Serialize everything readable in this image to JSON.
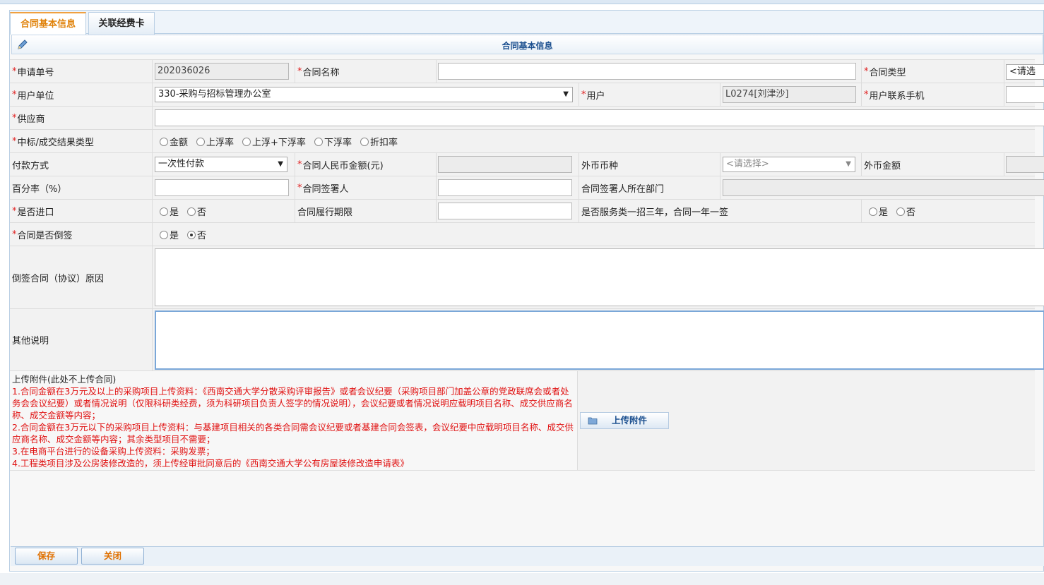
{
  "tabs": [
    {
      "label": "合同基本信息",
      "active": true
    },
    {
      "label": "关联经费卡",
      "active": false
    }
  ],
  "section": {
    "title": "合同基本信息"
  },
  "fields": {
    "apply_no": {
      "label": "申请单号",
      "value": "202036026"
    },
    "contract_name": {
      "label": "合同名称",
      "value": ""
    },
    "contract_type": {
      "label": "合同类型",
      "value": "<请选"
    },
    "user_unit": {
      "label": "用户单位",
      "value": "330-采购与招标管理办公室"
    },
    "user": {
      "label": "用户",
      "value": "L0274[刘津沙]"
    },
    "user_phone": {
      "label": "用户联系手机",
      "value": ""
    },
    "supplier": {
      "label": "供应商",
      "value": ""
    },
    "result_type": {
      "label": "中标/成交结果类型",
      "options": [
        "金额",
        "上浮率",
        "上浮+下浮率",
        "下浮率",
        "折扣率"
      ]
    },
    "pay_method": {
      "label": "付款方式",
      "value": "一次性付款"
    },
    "rmb_amount": {
      "label": "合同人民币金额(元)",
      "value": ""
    },
    "fx_currency": {
      "label": "外币币种",
      "value": "<请选择>"
    },
    "fx_amount": {
      "label": "外币金额",
      "value": ""
    },
    "percent": {
      "label": "百分率（%）",
      "value": ""
    },
    "signer": {
      "label": "合同签署人",
      "value": ""
    },
    "signer_dept": {
      "label": "合同签署人所在部门",
      "value": ""
    },
    "is_import": {
      "label": "是否进口",
      "yes": "是",
      "no": "否"
    },
    "term": {
      "label": "合同履行期限",
      "value": ""
    },
    "service_3yr": {
      "label": "是否服务类一招三年，合同一年一签",
      "yes": "是",
      "no": "否"
    },
    "backdated": {
      "label": "合同是否倒签",
      "yes": "是",
      "no": "否",
      "selected": "否"
    },
    "backdate_reason": {
      "label": "倒签合同（协议）原因",
      "value": ""
    },
    "other": {
      "label": "其他说明",
      "value": ""
    }
  },
  "upload": {
    "heading": "上传附件(此处不上传合同)",
    "notes": [
      "1.合同金额在3万元及以上的采购项目上传资料：《西南交通大学分散采购评审报告》或者会议纪要（采购项目部门加盖公章的党政联席会或者处务会会议纪要）或者情况说明（仅限科研类经费，须为科研项目负责人签字的情况说明），会议纪要或者情况说明应载明项目名称、成交供应商名称、成交金额等内容；",
      "2.合同金额在3万元以下的采购项目上传资料：与基建项目相关的各类合同需会议纪要或者基建合同会签表，会议纪要中应载明项目名称、成交供应商名称、成交金额等内容；其余类型项目不需要；",
      "3.在电商平台进行的设备采购上传资料：采购发票；",
      "4.工程类项目涉及公房装修改造的，须上传经审批同意后的《西南交通大学公有房屋装修改造申请表》"
    ],
    "button_label": "上传附件"
  },
  "footer": {
    "save_label": "保存",
    "close_label": "关闭"
  },
  "colors": {
    "accent": "#e0820a",
    "title_blue": "#1b4f8f",
    "required": "#e02020",
    "border": "#b9cfe4"
  }
}
